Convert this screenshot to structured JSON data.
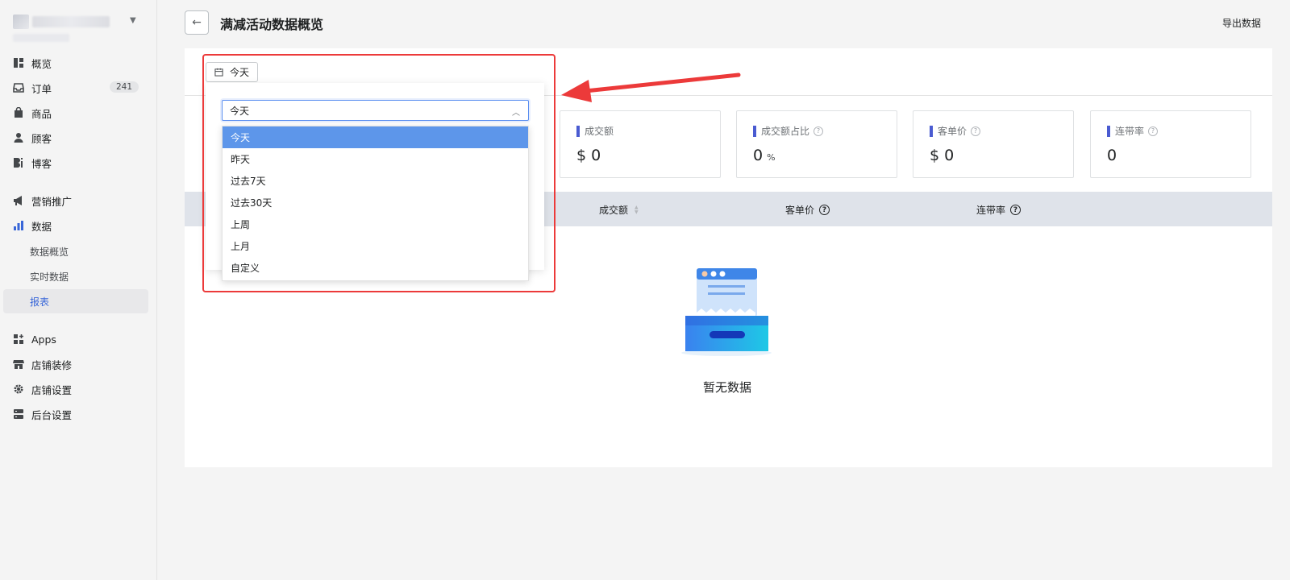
{
  "sidebar": {
    "nav": [
      {
        "label": "概览",
        "icon": "dashboard-icon"
      },
      {
        "label": "订单",
        "icon": "inbox-icon",
        "badge": "241"
      },
      {
        "label": "商品",
        "icon": "tag-icon"
      },
      {
        "label": "顾客",
        "icon": "person-icon"
      },
      {
        "label": "博客",
        "icon": "blog-icon"
      },
      {
        "label": "营销推广",
        "icon": "megaphone-icon"
      },
      {
        "label": "数据",
        "icon": "bar-chart-icon"
      },
      {
        "label": "Apps",
        "icon": "apps-icon"
      },
      {
        "label": "店铺装修",
        "icon": "storefront-icon"
      },
      {
        "label": "店铺设置",
        "icon": "gear-icon"
      },
      {
        "label": "后台设置",
        "icon": "server-icon"
      }
    ],
    "data_sub": [
      "数据概览",
      "实时数据",
      "报表"
    ]
  },
  "header": {
    "title": "满减活动数据概览",
    "export_label": "导出数据"
  },
  "date_filter": {
    "button_label": "今天",
    "input_value": "今天",
    "options": [
      "今天",
      "昨天",
      "过去7天",
      "过去30天",
      "上周",
      "上月",
      "自定义"
    ],
    "selected": "今天"
  },
  "metrics": [
    {
      "label": "成交额",
      "value": "$ 0",
      "help": false
    },
    {
      "label": "成交额占比",
      "value": "0",
      "unit": "%",
      "help": true
    },
    {
      "label": "客单价",
      "value": "$ 0",
      "help": true
    },
    {
      "label": "连带率",
      "value": "0",
      "help": true
    }
  ],
  "table": {
    "headers": [
      {
        "label": "成交额",
        "sortable": true
      },
      {
        "label": "客单价",
        "help": true
      },
      {
        "label": "连带率",
        "help": true
      }
    ],
    "empty_text": "暂无数据"
  },
  "colors": {
    "accent": "#4a5bd1",
    "selected_option": "#5d96ea",
    "annotation_red": "#ec3a3a"
  }
}
